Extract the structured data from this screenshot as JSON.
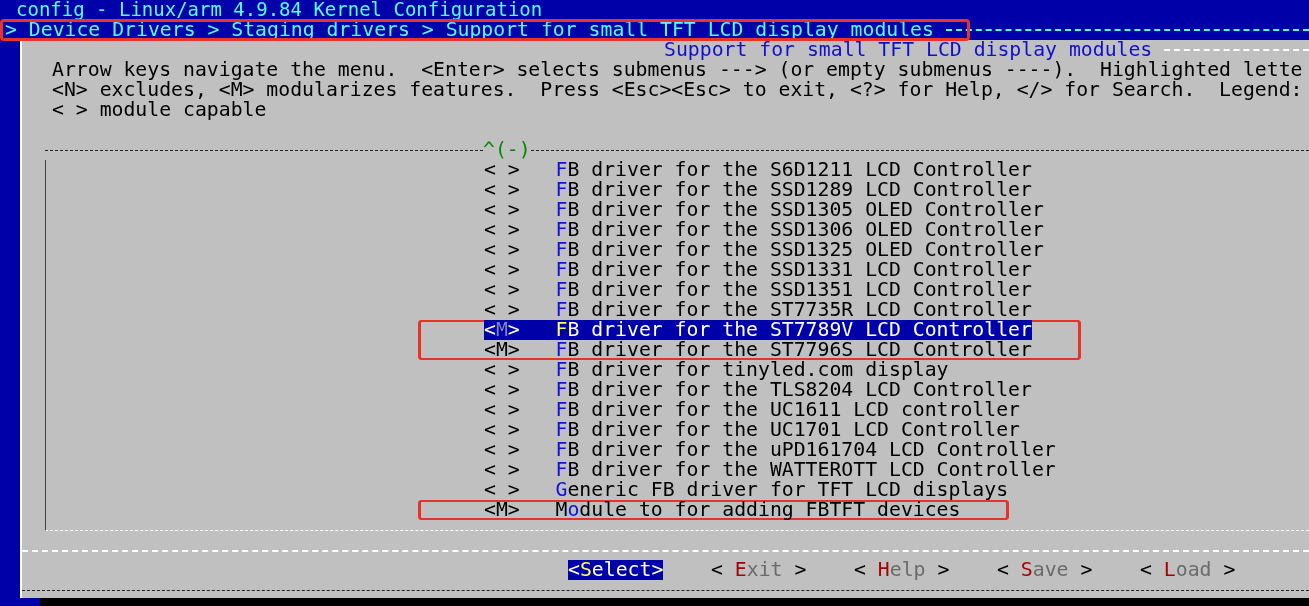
{
  "window": {
    "title": "config - Linux/arm 4.9.84 Kernel Configuration"
  },
  "breadcrumb": {
    "text": "> Device Drivers > Staging drivers > Support for small TFT LCD display modules",
    "marked": true
  },
  "dialog": {
    "title": "Support for small TFT LCD display modules",
    "help": [
      "Arrow keys navigate the menu.  <Enter> selects submenus ---> (or empty submenus ----).  Highlighted lette",
      "<N> excludes, <M> modularizes features.  Press <Esc><Esc> to exit, <?> for Help, </> for Search.  Legend:",
      "< > module capable"
    ],
    "scroll_indicator": "^(-)",
    "items": [
      {
        "mark": "< >",
        "hotkey": "F",
        "label": "B driver for the S6D1211 LCD Controller",
        "selected": false,
        "marked": false
      },
      {
        "mark": "< >",
        "hotkey": "F",
        "label": "B driver for the SSD1289 LCD Controller",
        "selected": false,
        "marked": false
      },
      {
        "mark": "< >",
        "hotkey": "F",
        "label": "B driver for the SSD1305 OLED Controller",
        "selected": false,
        "marked": false
      },
      {
        "mark": "< >",
        "hotkey": "F",
        "label": "B driver for the SSD1306 OLED Controller",
        "selected": false,
        "marked": false
      },
      {
        "mark": "< >",
        "hotkey": "F",
        "label": "B driver for the SSD1325 OLED Controller",
        "selected": false,
        "marked": false
      },
      {
        "mark": "< >",
        "hotkey": "F",
        "label": "B driver for the SSD1331 LCD Controller",
        "selected": false,
        "marked": false
      },
      {
        "mark": "< >",
        "hotkey": "F",
        "label": "B driver for the SSD1351 LCD Controller",
        "selected": false,
        "marked": false
      },
      {
        "mark": "< >",
        "hotkey": "F",
        "label": "B driver for the ST7735R LCD Controller",
        "selected": false,
        "marked": false
      },
      {
        "mark": "<M>",
        "hotkey": "F",
        "label": "B driver for the ST7789V LCD Controller",
        "selected": true,
        "marked": true
      },
      {
        "mark": "<M>",
        "hotkey": "F",
        "label": "B driver for the ST7796S LCD Controller",
        "selected": false,
        "marked": true
      },
      {
        "mark": "< >",
        "hotkey": "F",
        "label": "B driver for tinyled.com display",
        "selected": false,
        "marked": false
      },
      {
        "mark": "< >",
        "hotkey": "F",
        "label": "B driver for the TLS8204 LCD Controller",
        "selected": false,
        "marked": false
      },
      {
        "mark": "< >",
        "hotkey": "F",
        "label": "B driver for the UC1611 LCD controller",
        "selected": false,
        "marked": false
      },
      {
        "mark": "< >",
        "hotkey": "F",
        "label": "B driver for the UC1701 LCD Controller",
        "selected": false,
        "marked": false
      },
      {
        "mark": "< >",
        "hotkey": "F",
        "label": "B driver for the uPD161704 LCD Controller",
        "selected": false,
        "marked": false
      },
      {
        "mark": "< >",
        "hotkey": "F",
        "label": "B driver for the WATTEROTT LCD Controller",
        "selected": false,
        "marked": false
      },
      {
        "mark": "< >",
        "hotkey": "G",
        "label": "eneric FB driver for TFT LCD displays",
        "selected": false,
        "marked": false
      },
      {
        "mark": "<M>",
        "lead": "M",
        "hotkey": "o",
        "label": "dule to for adding FBTFT devices",
        "selected": false,
        "marked": true
      }
    ],
    "buttons": [
      {
        "left": "<",
        "hotkey": "S",
        "label": "elect",
        "right": ">",
        "selected": true
      },
      {
        "left": "< ",
        "hotkey": "E",
        "label": "xit",
        "right": " >",
        "selected": false
      },
      {
        "left": "< ",
        "hotkey": "H",
        "label": "elp",
        "right": " >",
        "selected": false
      },
      {
        "left": "< ",
        "hotkey": "S",
        "label": "ave",
        "right": " >",
        "selected": false
      },
      {
        "left": "< ",
        "hotkey": "L",
        "label": "oad",
        "right": " >",
        "selected": false
      }
    ]
  }
}
